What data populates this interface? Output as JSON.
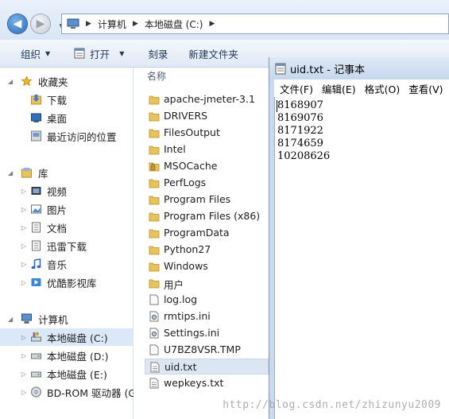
{
  "address_bar": {
    "breadcrumbs": [
      "计算机",
      "本地磁盘 (C:)"
    ]
  },
  "toolbar": {
    "organize": "组织",
    "open": "打开",
    "burn": "刻录",
    "new_folder": "新建文件夹"
  },
  "nav_pane": {
    "favorites": {
      "label": "收藏夹",
      "items": [
        "下载",
        "桌面",
        "最近访问的位置"
      ]
    },
    "libraries": {
      "label": "库",
      "items": [
        "视频",
        "图片",
        "文档",
        "迅雷下载",
        "音乐",
        "优酷影视库"
      ]
    },
    "computer": {
      "label": "计算机",
      "items": [
        "本地磁盘 (C:)",
        "本地磁盘 (D:)",
        "本地磁盘 (E:)",
        "BD-ROM 驱动器 (G"
      ]
    }
  },
  "file_list": {
    "column_name": "名称",
    "files": [
      {
        "name": "apache-jmeter-3.1",
        "icon": "folder-icon"
      },
      {
        "name": "DRIVERS",
        "icon": "folder-icon"
      },
      {
        "name": "FilesOutput",
        "icon": "folder-icon"
      },
      {
        "name": "Intel",
        "icon": "folder-icon"
      },
      {
        "name": "MSOCache",
        "icon": "locked-folder-icon"
      },
      {
        "name": "PerfLogs",
        "icon": "folder-icon"
      },
      {
        "name": "Program Files",
        "icon": "folder-icon"
      },
      {
        "name": "Program Files (x86)",
        "icon": "folder-icon"
      },
      {
        "name": "ProgramData",
        "icon": "folder-icon"
      },
      {
        "name": "Python27",
        "icon": "folder-icon"
      },
      {
        "name": "Windows",
        "icon": "folder-icon"
      },
      {
        "name": "用户",
        "icon": "folder-icon"
      },
      {
        "name": "log.log",
        "icon": "file-icon"
      },
      {
        "name": "rmtips.ini",
        "icon": "settings-file-icon"
      },
      {
        "name": "Settings.ini",
        "icon": "settings-file-icon"
      },
      {
        "name": "U7BZ8VSR.TMP",
        "icon": "file-icon"
      },
      {
        "name": "uid.txt",
        "icon": "text-file-icon"
      },
      {
        "name": "wepkeys.txt",
        "icon": "text-file-icon"
      }
    ]
  },
  "notepad": {
    "title": "uid.txt - 记事本",
    "menu": [
      "文件(F)",
      "编辑(E)",
      "格式(O)",
      "查看(V)"
    ],
    "lines": [
      "8168907",
      "8169076",
      "8171922",
      "8174659",
      "10208626"
    ]
  },
  "watermark": "http://blog.csdn.net/zhizunyu2009",
  "colors": {
    "folder": "#e8c25a",
    "selection": "#dbe8f7",
    "toolbar_text": "#1e395b",
    "notepad_frame": "#c9daee"
  }
}
